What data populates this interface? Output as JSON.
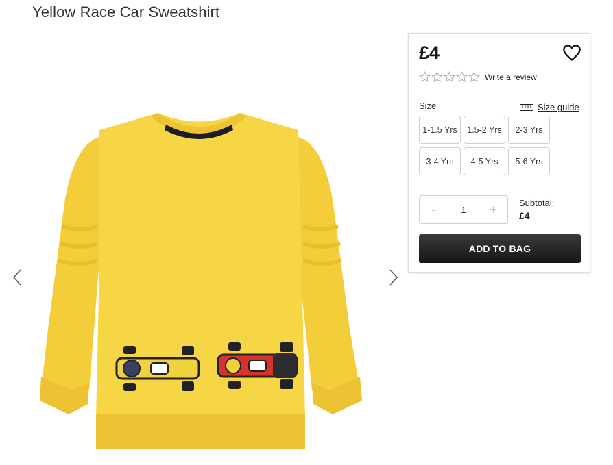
{
  "product": {
    "title": "Yellow Race Car Sweatshirt",
    "image_alt": "Yellow sweatshirt with race car print",
    "shirt_color": "#F6D644"
  },
  "gallery": {
    "prev_icon": "chevron-left-icon",
    "next_icon": "chevron-right-icon"
  },
  "panel": {
    "price": "£4",
    "rating_stars": 0,
    "rating_max": 5,
    "write_review": "Write a review",
    "size_label": "Size",
    "size_guide": "Size guide",
    "sizes": [
      "1-1.5 Yrs",
      "1.5-2 Yrs",
      "2-3 Yrs",
      "3-4 Yrs",
      "4-5 Yrs",
      "5-6 Yrs"
    ],
    "quantity": {
      "minus": "-",
      "value": "1",
      "plus": "+"
    },
    "subtotal_label": "Subtotal:",
    "subtotal_value": "£4",
    "add_to_bag": "ADD TO BAG"
  }
}
